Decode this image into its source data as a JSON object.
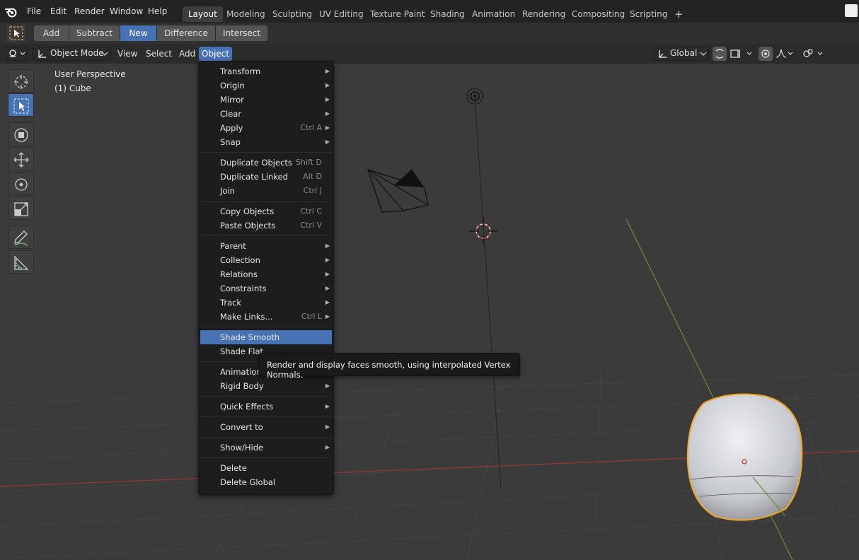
{
  "menubar": {
    "items": [
      "File",
      "Edit",
      "Render",
      "Window",
      "Help"
    ],
    "workspace_tabs": [
      "Layout",
      "Modeling",
      "Sculpting",
      "UV Editing",
      "Texture Paint",
      "Shading",
      "Animation",
      "Rendering",
      "Compositing",
      "Scripting"
    ],
    "active_tab": "Layout",
    "add_tab": "+"
  },
  "tool_header": {
    "modes": [
      "Add",
      "Subtract",
      "New",
      "Difference",
      "Intersect"
    ],
    "active_mode": "New"
  },
  "viewport_header": {
    "mode": "Object Mode",
    "menus": [
      "View",
      "Select",
      "Add",
      "Object"
    ],
    "active_menu": "Object",
    "orientation": "Global"
  },
  "viewport": {
    "perspective": "User Perspective",
    "object_info": "(1) Cube"
  },
  "object_menu": {
    "items": [
      {
        "label": "Transform",
        "shortcut": "",
        "submenu": true
      },
      {
        "label": "Origin",
        "shortcut": "",
        "submenu": true
      },
      {
        "label": "Mirror",
        "shortcut": "",
        "submenu": true
      },
      {
        "label": "Clear",
        "shortcut": "",
        "submenu": true
      },
      {
        "label": "Apply",
        "shortcut": "Ctrl A",
        "submenu": true
      },
      {
        "label": "Snap",
        "shortcut": "",
        "submenu": true
      },
      {
        "label": "Duplicate Objects",
        "shortcut": "Shift D",
        "submenu": false
      },
      {
        "label": "Duplicate Linked",
        "shortcut": "Alt D",
        "submenu": false
      },
      {
        "label": "Join",
        "shortcut": "Ctrl J",
        "submenu": false
      },
      {
        "label": "Copy Objects",
        "shortcut": "Ctrl C",
        "submenu": false
      },
      {
        "label": "Paste Objects",
        "shortcut": "Ctrl V",
        "submenu": false
      },
      {
        "label": "Parent",
        "shortcut": "",
        "submenu": true
      },
      {
        "label": "Collection",
        "shortcut": "",
        "submenu": true
      },
      {
        "label": "Relations",
        "shortcut": "",
        "submenu": true
      },
      {
        "label": "Constraints",
        "shortcut": "",
        "submenu": true
      },
      {
        "label": "Track",
        "shortcut": "",
        "submenu": true
      },
      {
        "label": "Make Links...",
        "shortcut": "Ctrl L",
        "submenu": true
      },
      {
        "label": "Shade Smooth",
        "shortcut": "",
        "submenu": false
      },
      {
        "label": "Shade Flat",
        "shortcut": "",
        "submenu": false
      },
      {
        "label": "Animation",
        "shortcut": "",
        "submenu": true
      },
      {
        "label": "Rigid Body",
        "shortcut": "",
        "submenu": true
      },
      {
        "label": "Quick Effects",
        "shortcut": "",
        "submenu": true
      },
      {
        "label": "Convert to",
        "shortcut": "",
        "submenu": true
      },
      {
        "label": "Show/Hide",
        "shortcut": "",
        "submenu": true
      },
      {
        "label": "Delete",
        "shortcut": "",
        "submenu": false
      },
      {
        "label": "Delete Global",
        "shortcut": "",
        "submenu": false
      }
    ],
    "highlighted": "Shade Smooth"
  },
  "tooltip": {
    "text": "Render and display faces smooth, using interpolated Vertex Normals."
  },
  "colors": {
    "accent": "#4772b3",
    "selection_outline": "#f5a623",
    "x_axis": "#b03a3a",
    "y_axis": "#6f9a2c"
  }
}
